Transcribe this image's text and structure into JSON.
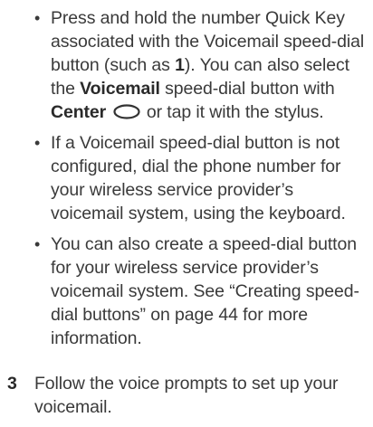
{
  "bullets": [
    {
      "marker": "•",
      "parts": [
        {
          "text": "Press and hold the number Quick Key associated with the Voicemail speed-dial button (such as "
        },
        {
          "text": "1",
          "bold": true
        },
        {
          "text": "). You can also select the "
        },
        {
          "text": "Voicemail",
          "bold": true
        },
        {
          "text": " speed-dial button with "
        },
        {
          "text": "Center",
          "bold": true
        },
        {
          "text": " "
        },
        {
          "icon": "center-button-icon"
        },
        {
          "text": " or tap it with the stylus."
        }
      ]
    },
    {
      "marker": "•",
      "parts": [
        {
          "text": "If a Voicemail speed-dial button is not configured, dial the phone number for your wireless service provider’s voicemail system, using the keyboard."
        }
      ]
    },
    {
      "marker": "•",
      "parts": [
        {
          "text": "You can also create a speed-dial button for your wireless service provider’s voicemail system. See “Creating speed-dial buttons” on page 44 for more information."
        }
      ]
    }
  ],
  "step": {
    "number": "3",
    "text": "Follow the voice prompts to set up your voicemail."
  }
}
